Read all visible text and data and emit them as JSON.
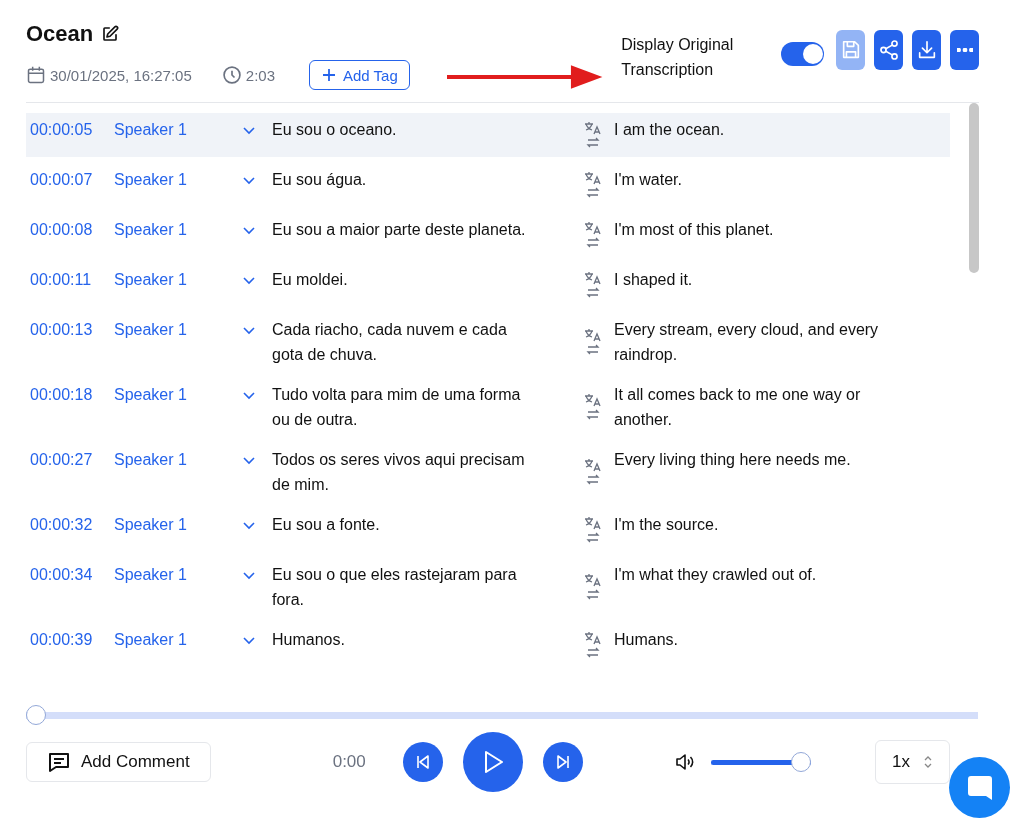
{
  "header": {
    "title": "Ocean",
    "date": "30/01/2025, 16:27:05",
    "duration": "2:03",
    "add_tag": "Add Tag",
    "display_original": {
      "label": "Display Original Transcription",
      "on": true
    },
    "actions": [
      {
        "kind": "save",
        "disabled": true
      },
      {
        "kind": "share",
        "disabled": false
      },
      {
        "kind": "download",
        "disabled": false
      },
      {
        "kind": "more",
        "disabled": false
      }
    ]
  },
  "rows": [
    {
      "time": "00:00:05",
      "speaker": "Speaker 1",
      "original": "Eu sou o oceano.",
      "translation": "I am the ocean.",
      "selected": true
    },
    {
      "time": "00:00:07",
      "speaker": "Speaker 1",
      "original": "Eu sou água.",
      "translation": "I'm water.",
      "selected": false
    },
    {
      "time": "00:00:08",
      "speaker": "Speaker 1",
      "original": "Eu sou a maior parte deste planeta.",
      "translation": "I'm most of this planet.",
      "selected": false
    },
    {
      "time": "00:00:11",
      "speaker": "Speaker 1",
      "original": "Eu moldei.",
      "translation": "I shaped it.",
      "selected": false
    },
    {
      "time": "00:00:13",
      "speaker": "Speaker 1",
      "original": "Cada riacho, cada nuvem e cada gota de chuva.",
      "translation": "Every stream, every cloud, and every raindrop.",
      "selected": false
    },
    {
      "time": "00:00:18",
      "speaker": "Speaker 1",
      "original": "Tudo volta para mim de uma forma ou de outra.",
      "translation": "It all comes back to me one way or another.",
      "selected": false
    },
    {
      "time": "00:00:27",
      "speaker": "Speaker 1",
      "original": "Todos os seres vivos aqui precisam de mim.",
      "translation": "Every living thing here needs me.",
      "selected": false
    },
    {
      "time": "00:00:32",
      "speaker": "Speaker 1",
      "original": "Eu sou a fonte.",
      "translation": "I'm the source.",
      "selected": false
    },
    {
      "time": "00:00:34",
      "speaker": "Speaker 1",
      "original": "Eu sou o que eles rastejaram para fora.",
      "translation": "I'm what they crawled out of.",
      "selected": false
    },
    {
      "time": "00:00:39",
      "speaker": "Speaker 1",
      "original": "Humanos.",
      "translation": "Humans.",
      "selected": false
    }
  ],
  "player": {
    "progress": {
      "level": 0
    },
    "add_comment": "Add Comment",
    "time": "0:00",
    "volume": {
      "level": 1
    },
    "speed": "1x"
  }
}
